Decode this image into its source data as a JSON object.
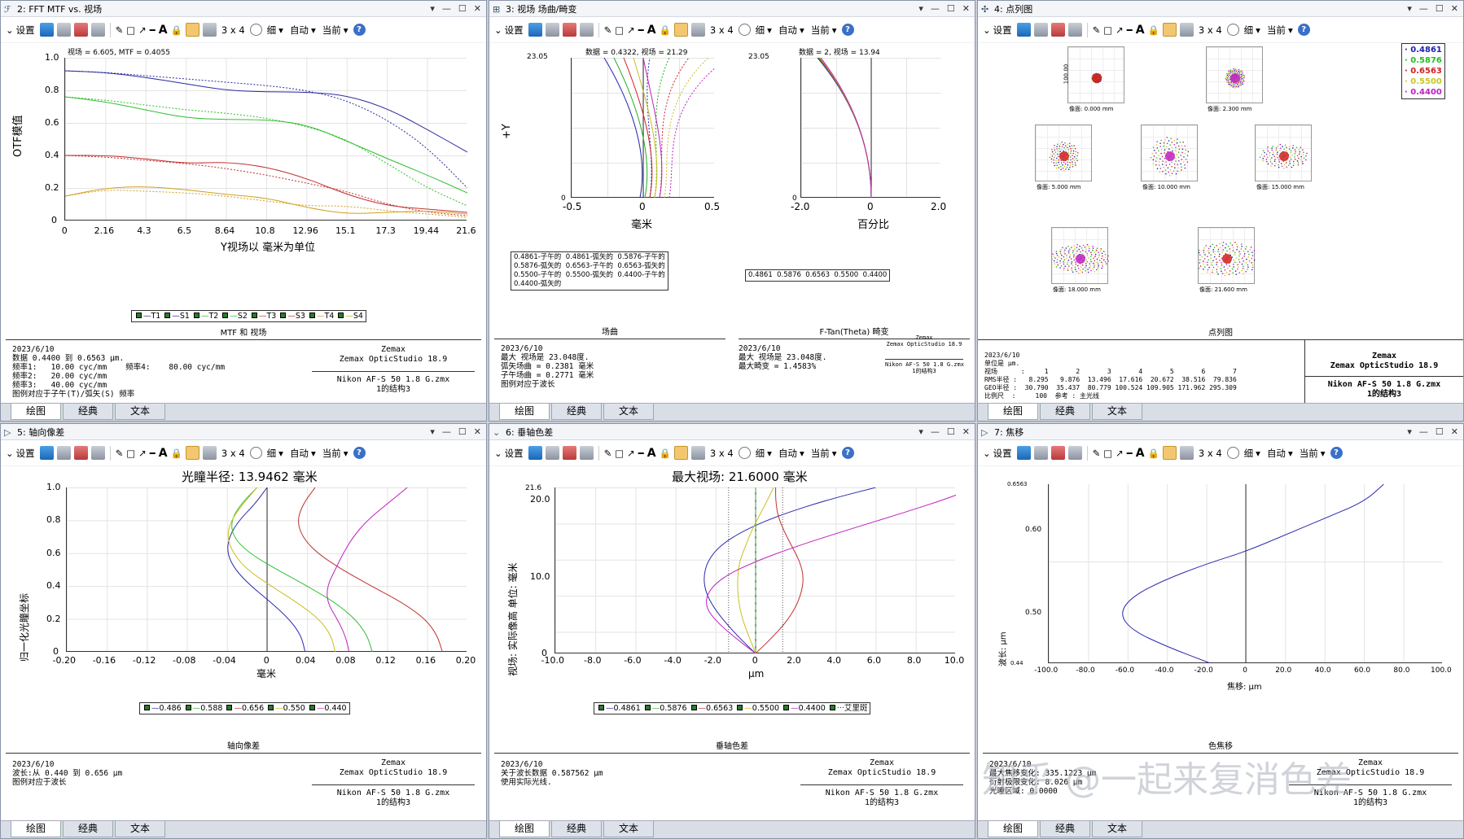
{
  "toolbar": {
    "settings": "设置",
    "grid": "3 x 4",
    "thin": "细",
    "auto": "自动",
    "current": "当前"
  },
  "tabs": [
    "绘图",
    "经典",
    "文本"
  ],
  "panes": {
    "mtf": {
      "title": "2: FFT MTF vs. 视场",
      "header": "视场 = 6.605, MTF = 0.4055",
      "ylabel": "OTF模值",
      "xlabel": "Y视场以 毫米为单位",
      "yticks": [
        "1.0",
        "0.8",
        "0.6",
        "0.4",
        "0.2",
        "0"
      ],
      "xticks": [
        "0",
        "2.16",
        "4.3",
        "6.5",
        "8.64",
        "10.8",
        "12.96",
        "15.1",
        "17.3",
        "19.44",
        "21.6"
      ],
      "legend": [
        "T1",
        "S1",
        "T2",
        "S2",
        "T3",
        "S3",
        "T4",
        "S4"
      ],
      "caption": "MTF 和 视场",
      "info": "2023/6/10\n数据 0.4400 到 0.6563 μm.\n频率1:   10.00 cyc/mm    频率4:    80.00 cyc/mm\n频率2:   20.00 cyc/mm\n频率3:   40.00 cyc/mm\n图例对应于子午(T)/弧矢(S) 频率",
      "brand": "Zemax\nZemax OpticStudio 18.9",
      "file": "Nikon AF-S 50 1.8 G.zmx\n1的结构3",
      "chart_data": {
        "type": "line",
        "xlabel": "Y视场以 毫米为单位",
        "ylabel": "OTF模值",
        "xlim": [
          0,
          21.6
        ],
        "ylim": [
          0,
          1.0
        ],
        "x": [
          0,
          2.16,
          4.3,
          6.5,
          8.64,
          10.8,
          12.96,
          15.1,
          17.3,
          19.44,
          21.6
        ],
        "series": [
          {
            "name": "T1",
            "color": "#2a2aa0",
            "dash": false,
            "values": [
              0.92,
              0.91,
              0.88,
              0.84,
              0.8,
              0.79,
              0.79,
              0.77,
              0.69,
              0.56,
              0.42
            ]
          },
          {
            "name": "S1",
            "color": "#2a2aa0",
            "dash": true,
            "values": [
              0.92,
              0.91,
              0.89,
              0.87,
              0.85,
              0.83,
              0.8,
              0.74,
              0.62,
              0.45,
              0.2
            ]
          },
          {
            "name": "T2",
            "color": "#30c030",
            "dash": false,
            "values": [
              0.76,
              0.73,
              0.68,
              0.63,
              0.62,
              0.62,
              0.59,
              0.49,
              0.38,
              0.28,
              0.17
            ]
          },
          {
            "name": "S2",
            "color": "#30c030",
            "dash": true,
            "values": [
              0.76,
              0.74,
              0.71,
              0.68,
              0.66,
              0.63,
              0.58,
              0.5,
              0.35,
              0.2,
              0.09
            ]
          },
          {
            "name": "T3",
            "color": "#c03030",
            "dash": false,
            "values": [
              0.4,
              0.4,
              0.38,
              0.35,
              0.36,
              0.33,
              0.26,
              0.16,
              0.09,
              0.07,
              0.05
            ]
          },
          {
            "name": "S3",
            "color": "#c03030",
            "dash": true,
            "values": [
              0.4,
              0.39,
              0.37,
              0.35,
              0.32,
              0.28,
              0.23,
              0.18,
              0.1,
              0.05,
              0.03
            ]
          },
          {
            "name": "T4",
            "color": "#d0a020",
            "dash": false,
            "values": [
              0.15,
              0.2,
              0.21,
              0.19,
              0.16,
              0.14,
              0.08,
              0.04,
              0.05,
              0.06,
              0.04
            ]
          },
          {
            "name": "S4",
            "color": "#d0a020",
            "dash": true,
            "values": [
              0.15,
              0.19,
              0.18,
              0.17,
              0.15,
              0.12,
              0.09,
              0.09,
              0.06,
              0.04,
              0.02
            ]
          }
        ]
      }
    },
    "field": {
      "title": "3: 视场 场曲/畸变",
      "header_left": "数据 = 0.4322, 视场 = 21.29",
      "header_right": "数据 = 2, 视场 = 13.94",
      "ytop": "23.05",
      "ylabel": "+Y",
      "left_xticks": [
        "-0.5",
        "0",
        "0.5"
      ],
      "left_xlabel": "毫米",
      "right_xticks": [
        "-2.0",
        "0",
        "2.0"
      ],
      "right_xlabel": "百分比",
      "legend_left": "0.4861-子午的  0.4861-弧矢的  0.5876-子午的\n0.5876-弧矢的  0.6563-子午的  0.6563-弧矢的\n0.5500-子午的  0.5500-弧矢的  0.4400-子午的\n0.4400-弧矢的",
      "legend_right": "0.4861  0.5876  0.6563  0.5500  0.4400",
      "cap_left": "场曲",
      "cap_right": "F-Tan(Theta) 畸变",
      "info_left": "2023/6/10\n最大 视场是 23.048度.\n弧矢场曲 = 0.2381 毫米\n子午场曲 = 0.2771 毫米\n图例对应于波长",
      "info_right": "2023/6/10\n最大 视场是 23.048度.\n最大畸变 = 1.4583%",
      "brand": "Zemax\nZemax OpticStudio 18.9",
      "file": "Nikon AF-S 50 1.8 G.zmx\n1的结构3"
    },
    "spot": {
      "title": "4: 点列图",
      "wavelengths": [
        "0.4861",
        "0.5876",
        "0.6563",
        "0.5500",
        "0.4400"
      ],
      "wcolors": [
        "#2020b0",
        "#20c020",
        "#d02020",
        "#c8c820",
        "#c020c0"
      ],
      "fields": [
        "像面: 0.000 mm",
        "像面: 2.300 mm",
        "像面: 5.000 mm",
        "像面: 10.000 mm",
        "像面: 15.000 mm",
        "像面: 18.000 mm",
        "像面: 21.600 mm"
      ],
      "scale": "100.00",
      "caption": "点列图",
      "info": "2023/6/10\n单位是 μm.\n视场      :     1       2       3       4       5       6       7\nRMS半径 :   8.295   9.876  13.496  17.616  20.672  38.516  79.836\nGEO半径 :  30.790  35.437  80.779 100.524 109.905 171.962 295.309\n比例尺  :     100  参考 : 主光线",
      "brand": "Zemax\nZemax OpticStudio 18.9",
      "file": "Nikon AF-S 50 1.8 G.zmx\n1的结构3"
    },
    "axial": {
      "title": "5: 轴向像差",
      "top": "光瞳半径: 13.9462 毫米",
      "ylabel": "归一化光瞳坐标",
      "xlabel": "毫米",
      "yticks": [
        "1.0",
        "0.8",
        "0.6",
        "0.4",
        "0.2",
        "0"
      ],
      "xticks": [
        "-0.20",
        "-0.16",
        "-0.12",
        "-0.08",
        "-0.04",
        "0",
        "0.04",
        "0.08",
        "0.12",
        "0.16",
        "0.20"
      ],
      "legend": [
        "0.486",
        "0.588",
        "0.656",
        "0.550",
        "0.440"
      ],
      "caption": "轴向像差",
      "info": "2023/6/10\n波长:从 0.440 到 0.656 μm\n图例对应于波长",
      "brand": "Zemax\nZemax OpticStudio 18.9",
      "file": "Nikon AF-S 50 1.8 G.zmx\n1的结构3",
      "chart_data": {
        "type": "line",
        "xlabel": "毫米",
        "ylabel": "归一化光瞳坐标",
        "xlim": [
          -0.2,
          0.2
        ],
        "ylim": [
          0,
          1.0
        ],
        "y": [
          0,
          0.1,
          0.2,
          0.3,
          0.4,
          0.5,
          0.6,
          0.7,
          0.8,
          0.9,
          1.0
        ],
        "series": [
          {
            "name": "0.486",
            "color": "#2a2ab0",
            "values": [
              0.038,
              0.034,
              0.022,
              0.004,
              -0.016,
              -0.032,
              -0.04,
              -0.038,
              -0.028,
              -0.012,
              0.0
            ]
          },
          {
            "name": "0.588",
            "color": "#30c030",
            "values": [
              0.105,
              0.1,
              0.088,
              0.068,
              0.04,
              0.01,
              -0.018,
              -0.034,
              -0.036,
              -0.026,
              -0.01
            ]
          },
          {
            "name": "0.656",
            "color": "#c03030",
            "values": [
              0.175,
              0.17,
              0.158,
              0.135,
              0.104,
              0.075,
              0.05,
              0.035,
              0.03,
              0.036,
              0.048
            ]
          },
          {
            "name": "0.550",
            "color": "#c8c020",
            "values": [
              0.068,
              0.064,
              0.052,
              0.03,
              0.004,
              -0.02,
              -0.034,
              -0.04,
              -0.036,
              -0.024,
              -0.01
            ]
          },
          {
            "name": "0.440",
            "color": "#c020c0",
            "values": [
              0.082,
              0.078,
              0.07,
              0.06,
              0.06,
              0.068,
              0.076,
              0.086,
              0.1,
              0.12,
              0.14
            ]
          }
        ]
      }
    },
    "lateral": {
      "title": "6: 垂轴色差",
      "top": "最大视场: 21.6000 毫米",
      "ytop": "21.6",
      "ylabel": "视场: 实际像高 单位: 毫米",
      "xlabel": "μm",
      "yticks": [
        "20.0",
        "10.0",
        "0"
      ],
      "xticks": [
        "-10.0",
        "-8.0",
        "-6.0",
        "-4.0",
        "-2.0",
        "0",
        "2.0",
        "4.0",
        "6.0",
        "8.0",
        "10.0"
      ],
      "legend": [
        "0.4861",
        "0.5876",
        "0.6563",
        "0.5500",
        "0.4400",
        "艾里斑"
      ],
      "caption": "垂轴色差",
      "info": "2023/6/10\n关于波长数据 0.587562 μm\n使用实际光线.",
      "brand": "Zemax\nZemax OpticStudio 18.9",
      "file": "Nikon AF-S 50 1.8 G.zmx\n1的结构3",
      "chart_data": {
        "type": "line",
        "xlabel": "μm",
        "ylabel": "视场: 实际像高 单位: 毫米",
        "xlim": [
          -10,
          10
        ],
        "ylim": [
          0,
          21.6
        ],
        "y": [
          0,
          2,
          4,
          6,
          8,
          10,
          12,
          14,
          16,
          18,
          20,
          21.6
        ],
        "series": [
          {
            "name": "0.4861",
            "color": "#2a2ab0",
            "values": [
              0,
              -0.8,
              -1.5,
              -2.1,
              -2.5,
              -2.6,
              -2.4,
              -1.8,
              -0.6,
              1.2,
              3.6,
              6.0
            ]
          },
          {
            "name": "0.5876",
            "color": "#30c030",
            "values": [
              0,
              0,
              0,
              0,
              0,
              0,
              0,
              0,
              0,
              0,
              0,
              0
            ]
          },
          {
            "name": "0.6563",
            "color": "#c03030",
            "values": [
              0,
              0.8,
              1.5,
              2.0,
              2.3,
              2.4,
              2.2,
              1.8,
              1.4,
              1.1,
              1.0,
              1.0
            ]
          },
          {
            "name": "0.5500",
            "color": "#c8c020",
            "values": [
              0,
              -0.3,
              -0.6,
              -0.8,
              -0.9,
              -0.9,
              -0.8,
              -0.5,
              -0.2,
              0.2,
              0.6,
              0.9
            ]
          },
          {
            "name": "0.4400",
            "color": "#c020c0",
            "values": [
              0,
              -1.0,
              -1.9,
              -2.5,
              -2.4,
              -1.6,
              0.0,
              2.1,
              4.5,
              7.0,
              9.4,
              11.0
            ]
          }
        ],
        "airy": [
          -1.35,
          1.35
        ]
      }
    },
    "focal": {
      "title": "7: 焦移",
      "ylabel": "波长: μm",
      "xlabel": "焦移: μm",
      "ytop": "0.6563",
      "ybottom": "0.44",
      "yticks": [
        "0.60",
        "0.50"
      ],
      "xticks": [
        "-100.0",
        "-80.0",
        "-60.0",
        "-40.0",
        "-20.0",
        "0",
        "20.0",
        "40.0",
        "60.0",
        "80.0",
        "100.0"
      ],
      "caption": "色焦移",
      "info": "2023/6/10\n最大焦移变化: 335.1223 μm\n衍射极限变化: 8.026 μm\n光瞳区域: 0.0000",
      "brand": "Zemax\nZemax OpticStudio 18.9",
      "file": "Nikon AF-S 50 1.8 G.zmx\n1的结构3",
      "chart_data": {
        "type": "line",
        "xlabel": "焦移: μm",
        "ylabel": "波长: μm",
        "xlim": [
          -100,
          100
        ],
        "ylim": [
          0.44,
          0.6563
        ],
        "series": [
          {
            "name": "焦移",
            "color": "#2a2ab0",
            "x": [
              -18,
              -40,
              -58,
              -64,
              -58,
              -42,
              -20,
              0,
              20,
              40,
              60,
              70
            ],
            "y": [
              0.44,
              0.46,
              0.48,
              0.5,
              0.52,
              0.54,
              0.56,
              0.575,
              0.595,
              0.615,
              0.635,
              0.6563
            ]
          }
        ]
      }
    }
  },
  "watermark": "知乎 @一起来复消色差"
}
